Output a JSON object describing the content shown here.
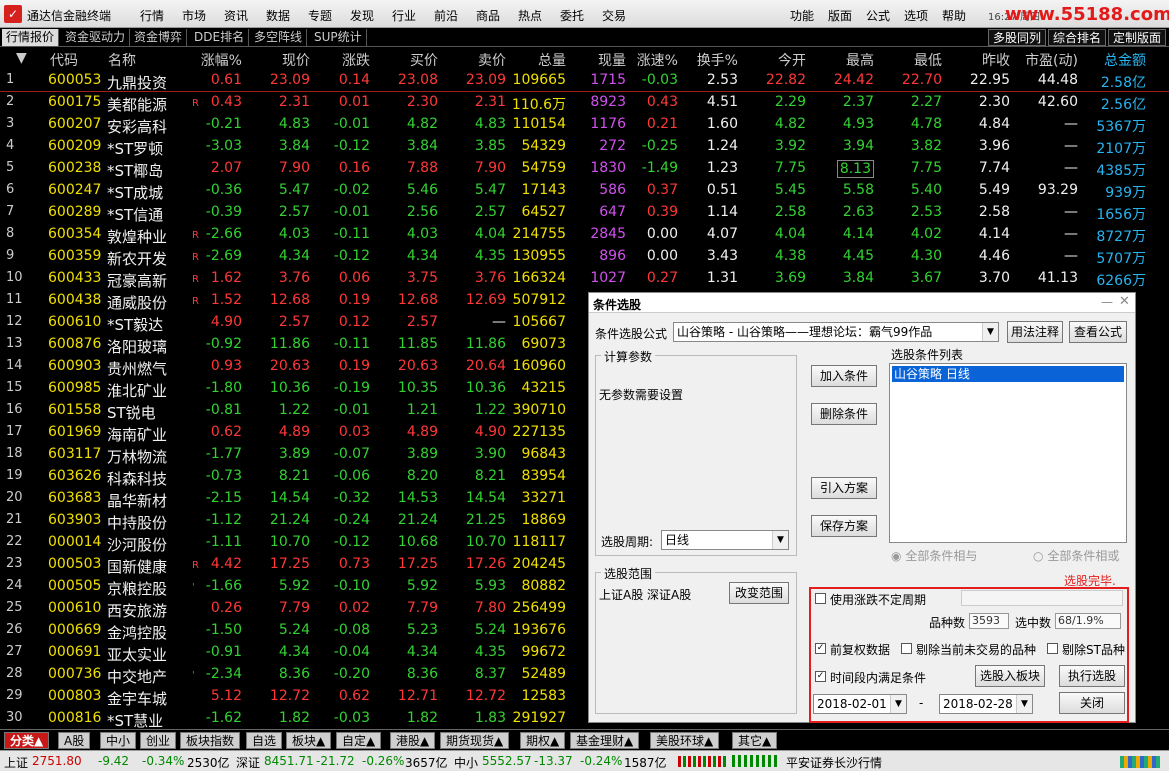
{
  "titlebar": {
    "app_title": "通达信金融终端",
    "menus": [
      "行情",
      "市场",
      "资讯",
      "数据",
      "专题",
      "发现",
      "行业",
      "前沿",
      "商品",
      "热点",
      "委托",
      "交易"
    ],
    "right_menus": [
      "功能",
      "版面",
      "公式",
      "选项",
      "帮助"
    ],
    "clock": "16:27 周四",
    "watermark": "www.55188.com"
  },
  "tabs": [
    "行情报价",
    "资金驱动力",
    "资金博弈",
    "DDE排名",
    "多空阵线",
    "SUP统计"
  ],
  "right_tabs": [
    "多股同列",
    "综合排名",
    "定制版面"
  ],
  "columns": [
    "代码",
    "名称",
    "涨幅%",
    "现价",
    "涨跌",
    "买价",
    "卖价",
    "总量",
    "现量",
    "涨速%",
    "换手%",
    "今开",
    "最高",
    "最低",
    "昨收",
    "市盈(动)",
    "总金额"
  ],
  "rows": [
    [
      "1",
      "600053",
      "九鼎投资",
      "",
      "0.61",
      "23.09",
      "0.14",
      "23.08",
      "23.09",
      "109665",
      "1715",
      "-0.03",
      "2.53",
      "22.82",
      "24.42",
      "22.70",
      "22.95",
      "44.48",
      "2.58亿"
    ],
    [
      "2",
      "600175",
      "美都能源",
      "R",
      "0.43",
      "2.31",
      "0.01",
      "2.30",
      "2.31",
      "110.6万",
      "8923",
      "0.43",
      "4.51",
      "2.29",
      "2.37",
      "2.27",
      "2.30",
      "42.60",
      "2.56亿"
    ],
    [
      "3",
      "600207",
      "安彩高科",
      "",
      "-0.21",
      "4.83",
      "-0.01",
      "4.82",
      "4.83",
      "110154",
      "1176",
      "0.21",
      "1.60",
      "4.82",
      "4.93",
      "4.78",
      "4.84",
      "—",
      "5367万"
    ],
    [
      "4",
      "600209",
      "*ST罗顿",
      "",
      "-3.03",
      "3.84",
      "-0.12",
      "3.84",
      "3.85",
      "54329",
      "272",
      "-0.25",
      "1.24",
      "3.92",
      "3.94",
      "3.82",
      "3.96",
      "—",
      "2107万"
    ],
    [
      "5",
      "600238",
      "*ST椰岛",
      "",
      "2.07",
      "7.90",
      "0.16",
      "7.88",
      "7.90",
      "54759",
      "1830",
      "-1.49",
      "1.23",
      "7.75",
      "8.13",
      "7.75",
      "7.74",
      "—",
      "4385万"
    ],
    [
      "6",
      "600247",
      "*ST成城",
      "",
      "-0.36",
      "5.47",
      "-0.02",
      "5.46",
      "5.47",
      "17143",
      "586",
      "0.37",
      "0.51",
      "5.45",
      "5.58",
      "5.40",
      "5.49",
      "93.29",
      "939万"
    ],
    [
      "7",
      "600289",
      "*ST信通",
      "",
      "-0.39",
      "2.57",
      "-0.01",
      "2.56",
      "2.57",
      "64527",
      "647",
      "0.39",
      "1.14",
      "2.58",
      "2.63",
      "2.53",
      "2.58",
      "—",
      "1656万"
    ],
    [
      "8",
      "600354",
      "敦煌种业",
      "R",
      "-2.66",
      "4.03",
      "-0.11",
      "4.03",
      "4.04",
      "214755",
      "2845",
      "0.00",
      "4.07",
      "4.04",
      "4.14",
      "4.02",
      "4.14",
      "—",
      "8727万"
    ],
    [
      "9",
      "600359",
      "新农开发",
      "R",
      "-2.69",
      "4.34",
      "-0.12",
      "4.34",
      "4.35",
      "130955",
      "896",
      "0.00",
      "3.43",
      "4.38",
      "4.45",
      "4.30",
      "4.46",
      "—",
      "5707万"
    ],
    [
      "10",
      "600433",
      "冠豪高新",
      "R",
      "1.62",
      "3.76",
      "0.06",
      "3.75",
      "3.76",
      "166324",
      "1027",
      "0.27",
      "1.31",
      "3.69",
      "3.84",
      "3.67",
      "3.70",
      "41.13",
      "6266万"
    ],
    [
      "11",
      "600438",
      "通威股份",
      "R",
      "1.52",
      "12.68",
      "0.19",
      "12.68",
      "12.69",
      "507912",
      "",
      "",
      "",
      "",
      "",
      "",
      "",
      "",
      ""
    ],
    [
      "12",
      "600610",
      "*ST毅达",
      "",
      "4.90",
      "2.57",
      "0.12",
      "2.57",
      "—",
      "105667",
      "",
      "",
      "",
      "",
      "",
      "",
      "",
      "",
      ""
    ],
    [
      "13",
      "600876",
      "洛阳玻璃",
      "",
      "-0.92",
      "11.86",
      "-0.11",
      "11.85",
      "11.86",
      "69073",
      "",
      "",
      "",
      "",
      "",
      "",
      "",
      "",
      ""
    ],
    [
      "14",
      "600903",
      "贵州燃气",
      "",
      "0.93",
      "20.63",
      "0.19",
      "20.63",
      "20.64",
      "160960",
      "",
      "",
      "",
      "",
      "",
      "",
      "",
      "",
      ""
    ],
    [
      "15",
      "600985",
      "淮北矿业",
      "",
      "-1.80",
      "10.36",
      "-0.19",
      "10.35",
      "10.36",
      "43215",
      "",
      "",
      "",
      "",
      "",
      "",
      "",
      "",
      ""
    ],
    [
      "16",
      "601558",
      "ST锐电",
      "",
      "-0.81",
      "1.22",
      "-0.01",
      "1.21",
      "1.22",
      "390710",
      "",
      "",
      "",
      "",
      "",
      "",
      "",
      "",
      ""
    ],
    [
      "17",
      "601969",
      "海南矿业",
      "",
      "0.62",
      "4.89",
      "0.03",
      "4.89",
      "4.90",
      "227135",
      "",
      "",
      "",
      "",
      "",
      "",
      "",
      "",
      ""
    ],
    [
      "18",
      "603117",
      "万林物流",
      "",
      "-1.77",
      "3.89",
      "-0.07",
      "3.89",
      "3.90",
      "96843",
      "",
      "",
      "",
      "",
      "",
      "",
      "",
      "",
      ""
    ],
    [
      "19",
      "603626",
      "科森科技",
      "",
      "-0.73",
      "8.21",
      "-0.06",
      "8.20",
      "8.21",
      "83954",
      "",
      "",
      "",
      "",
      "",
      "",
      "",
      "",
      ""
    ],
    [
      "20",
      "603683",
      "晶华新材",
      "",
      "-2.15",
      "14.54",
      "-0.32",
      "14.53",
      "14.54",
      "33271",
      "",
      "",
      "",
      "",
      "",
      "",
      "",
      "",
      ""
    ],
    [
      "21",
      "603903",
      "中持股份",
      "",
      "-1.12",
      "21.24",
      "-0.24",
      "21.24",
      "21.25",
      "18869",
      "",
      "",
      "",
      "",
      "",
      "",
      "",
      "",
      ""
    ],
    [
      "22",
      "000014",
      "沙河股份",
      "",
      "-1.11",
      "10.70",
      "-0.12",
      "10.68",
      "10.70",
      "118117",
      "",
      "",
      "",
      "",
      "",
      "",
      "",
      "",
      ""
    ],
    [
      "23",
      "000503",
      "国新健康",
      "R",
      "4.42",
      "17.25",
      "0.73",
      "17.25",
      "17.26",
      "204245",
      "",
      "",
      "",
      "",
      "",
      "",
      "",
      "",
      ""
    ],
    [
      "24",
      "000505",
      "京粮控股",
      "'",
      "-1.66",
      "5.92",
      "-0.10",
      "5.92",
      "5.93",
      "80882",
      "",
      "",
      "",
      "",
      "",
      "",
      "",
      "",
      ""
    ],
    [
      "25",
      "000610",
      "西安旅游",
      "",
      "0.26",
      "7.79",
      "0.02",
      "7.79",
      "7.80",
      "256499",
      "",
      "",
      "",
      "",
      "",
      "",
      "",
      "",
      ""
    ],
    [
      "26",
      "000669",
      "金鸿控股",
      "",
      "-1.50",
      "5.24",
      "-0.08",
      "5.23",
      "5.24",
      "193676",
      "",
      "",
      "",
      "",
      "",
      "",
      "",
      "",
      ""
    ],
    [
      "27",
      "000691",
      "亚太实业",
      "",
      "-0.91",
      "4.34",
      "-0.04",
      "4.34",
      "4.35",
      "99672",
      "",
      "",
      "",
      "",
      "",
      "",
      "",
      "",
      ""
    ],
    [
      "28",
      "000736",
      "中交地产",
      "'",
      "-2.34",
      "8.36",
      "-0.20",
      "8.36",
      "8.37",
      "52489",
      "",
      "",
      "",
      "",
      "",
      "",
      "",
      "",
      ""
    ],
    [
      "29",
      "000803",
      "金宇车城",
      "",
      "5.12",
      "12.72",
      "0.62",
      "12.71",
      "12.72",
      "12583",
      "",
      "",
      "",
      "",
      "",
      "",
      "",
      "",
      ""
    ],
    [
      "30",
      "000816",
      "*ST慧业",
      "",
      "-1.62",
      "1.82",
      "-0.03",
      "1.82",
      "1.83",
      "291927",
      "",
      "",
      "",
      "",
      "",
      "",
      "",
      "",
      ""
    ]
  ],
  "dialog": {
    "title": "条件选股",
    "formula_label": "条件选股公式",
    "formula_value": "山谷策略    - 山谷策略——理想论坛：霸气99作品",
    "btn_usage": "用法注释",
    "btn_view": "查看公式",
    "params_group": "计算参数",
    "params_text": "无参数需要设置",
    "btn_add": "加入条件",
    "btn_delete": "删除条件",
    "btn_import": "引入方案",
    "btn_save": "保存方案",
    "list_label": "选股条件列表",
    "list_items": [
      "山谷策略   日线"
    ],
    "period_label": "选股周期:",
    "period_value": "日线",
    "radio_and": "全部条件相与",
    "radio_or": "全部条件相或",
    "range_group": "选股范围",
    "range_value": "上证A股 深证A股",
    "btn_range": "改变范围",
    "done_text": "选股完毕.",
    "chk_uncertain": "使用涨跌不定周期",
    "count_label": "品种数",
    "count_value": "3593",
    "hit_label": "选中数",
    "hit_value": "68/1.9%",
    "chk_forward": "前复权数据",
    "chk_exclude_untraded": "剔除当前未交易的品种",
    "chk_exclude_st": "剔除ST品种",
    "chk_time": "时间段内满足条件",
    "btn_to_block": "选股入板块",
    "btn_run": "执行选股",
    "date_from": "2018-02-01",
    "date_sep": "-",
    "date_to": "2018-02-28",
    "btn_close": "关闭"
  },
  "bottom_tabs": [
    "分类▲",
    "A股",
    "中小",
    "创业",
    "板块指数",
    "自选",
    "板块▲",
    "自定▲",
    "港股▲",
    "期货现货▲",
    "期权▲",
    "基金理财▲",
    "美股环球▲",
    "其它▲"
  ],
  "status": {
    "sh_label": "上证",
    "sh_val": "2751.80",
    "sh_chg": "-9.42",
    "sh_pct": "-0.34%",
    "sh_amt": "2530亿",
    "sz_label": "深证",
    "sz_val": "8451.71",
    "sz_chg": "-21.72",
    "sz_pct": "-0.26%",
    "sz_amt": "3657亿",
    "zx_label": "中小",
    "zx_val": "5552.57",
    "zx_chg": "-13.37",
    "zx_pct": "-0.24%",
    "zx_amt": "1587亿",
    "broker": "平安证券长沙行情"
  },
  "colors": {
    "up": "#ff3838",
    "down": "#32d232",
    "code": "#f0e000",
    "volume": "#d250f0",
    "amount": "#28b4f0",
    "dialog_highlight": "#e41e1e",
    "list_select": "#0a64d8"
  }
}
